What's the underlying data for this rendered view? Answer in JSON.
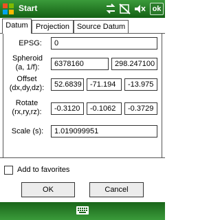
{
  "titlebar": {
    "title": "Start",
    "ok_label": "ok"
  },
  "tabs": [
    {
      "label": "Datum",
      "active": true
    },
    {
      "label": "Projection",
      "active": false
    },
    {
      "label": "Source Datum",
      "active": false
    }
  ],
  "datum": {
    "epsg_label": "EPSG:",
    "epsg_value": "0",
    "spheroid_label_line1": "Spheroid",
    "spheroid_label_line2": "(a, 1/f):",
    "spheroid_a": "6378160",
    "spheroid_f": "298.247100",
    "offset_label_line1": "Offset",
    "offset_label_line2": "(dx,dy,dz):",
    "offset_dx": "52.6839",
    "offset_dy": "-71.194",
    "offset_dz": "-13.975",
    "rotate_label_line1": "Rotate",
    "rotate_label_line2": "(rx,ry,rz):",
    "rotate_rx": "-0.3120",
    "rotate_ry": "-0.1062",
    "rotate_rz": "-0.3729",
    "scale_label": "Scale (s):",
    "scale_value": "1.019099951"
  },
  "favorites": {
    "label": "Add to favorites",
    "checked": false
  },
  "buttons": {
    "ok": "OK",
    "cancel": "Cancel"
  },
  "icons": {
    "start": "windows-logo-icon",
    "connectivity": "connectivity-icon",
    "signal": "signal-off-icon",
    "volume": "volume-icon",
    "keyboard": "keyboard-icon"
  }
}
